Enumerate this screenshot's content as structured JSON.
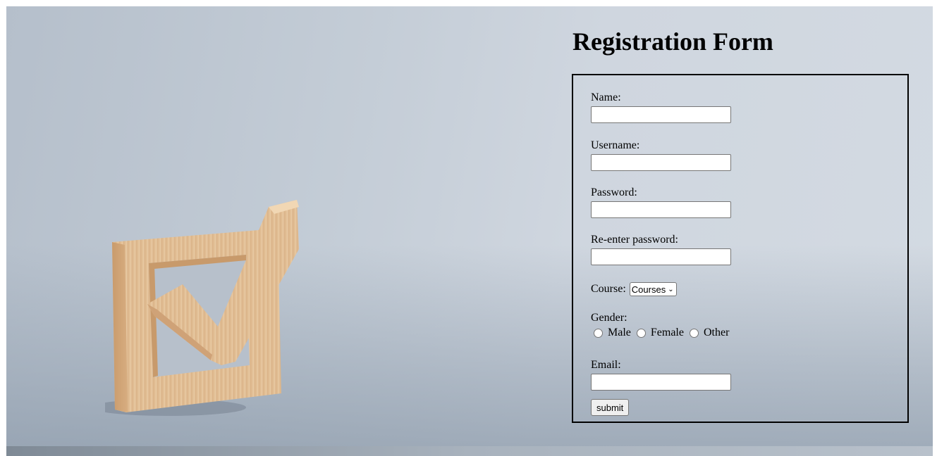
{
  "form": {
    "title": "Registration Form",
    "name_label": "Name:",
    "name_value": "",
    "username_label": "Username:",
    "username_value": "",
    "password_label": "Password:",
    "password_value": "",
    "reenter_label": "Re-enter password:",
    "reenter_value": "",
    "course_label": "Course:",
    "course_selected": "Courses",
    "gender_label": "Gender:",
    "gender_options": [
      "Male",
      "Female",
      "Other"
    ],
    "email_label": "Email:",
    "email_value": "",
    "submit_label": "submit"
  },
  "background": {
    "image": "wooden-checkmark-box",
    "wood_color": "#e3c29a",
    "backdrop_color": "#c7cfd9"
  }
}
